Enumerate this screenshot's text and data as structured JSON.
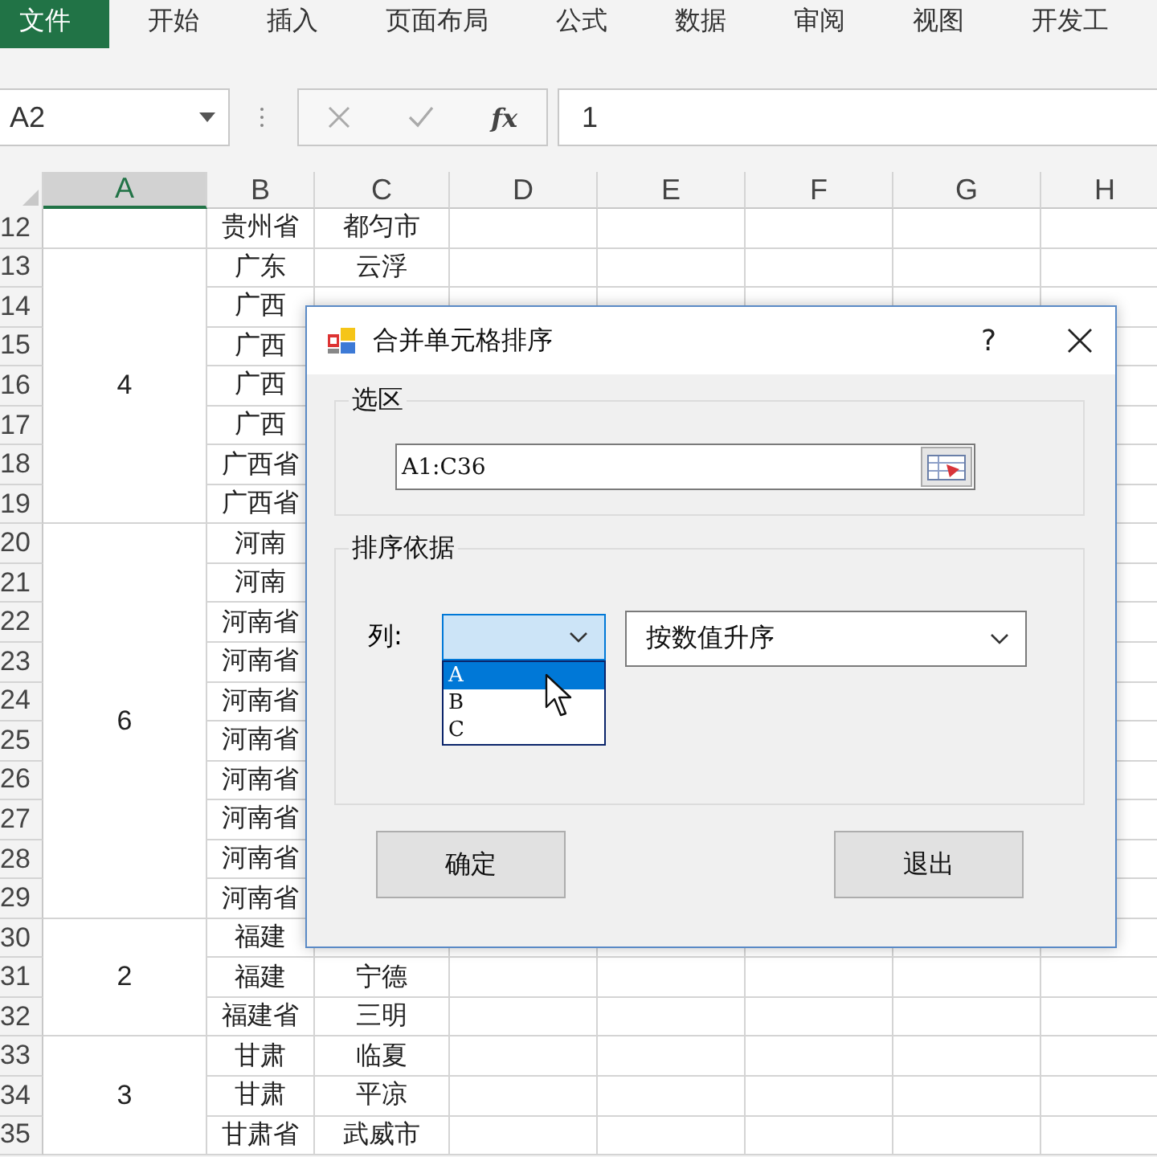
{
  "ribbon": {
    "tabs": [
      {
        "label": "文件",
        "kind": "file"
      },
      {
        "label": "开始",
        "kind": "tab"
      },
      {
        "label": "插入",
        "kind": "tab"
      },
      {
        "label": "页面布局",
        "kind": "tab"
      },
      {
        "label": "公式",
        "kind": "tab"
      },
      {
        "label": "数据",
        "kind": "tab"
      },
      {
        "label": "审阅",
        "kind": "tab"
      },
      {
        "label": "视图",
        "kind": "tab"
      },
      {
        "label": "开发工",
        "kind": "tab"
      }
    ]
  },
  "formula_bar": {
    "name_box": "A2",
    "function_label": "fx",
    "value": "1"
  },
  "sheet": {
    "columns": [
      {
        "label": "A",
        "selected": true
      },
      {
        "label": "B",
        "selected": false
      },
      {
        "label": "C",
        "selected": false
      },
      {
        "label": "D",
        "selected": false
      },
      {
        "label": "E",
        "selected": false
      },
      {
        "label": "F",
        "selected": false
      },
      {
        "label": "G",
        "selected": false
      },
      {
        "label": "H",
        "selected": false
      }
    ],
    "row_groups": [
      {
        "rows": [
          {
            "number": "12",
            "b": "贵州省",
            "c": "都匀市"
          }
        ]
      },
      {
        "a": "4",
        "rows": [
          {
            "number": "13",
            "b": "广东",
            "c": "云浮"
          },
          {
            "number": "14",
            "b": "广西"
          },
          {
            "number": "15",
            "b": "广西"
          },
          {
            "number": "16",
            "b": "广西"
          },
          {
            "number": "17",
            "b": "广西"
          },
          {
            "number": "18",
            "b": "广西省"
          },
          {
            "number": "19",
            "b": "广西省"
          }
        ]
      },
      {
        "a": "6",
        "rows": [
          {
            "number": "20",
            "b": "河南"
          },
          {
            "number": "21",
            "b": "河南"
          },
          {
            "number": "22",
            "b": "河南省"
          },
          {
            "number": "23",
            "b": "河南省"
          },
          {
            "number": "24",
            "b": "河南省"
          },
          {
            "number": "25",
            "b": "河南省"
          },
          {
            "number": "26",
            "b": "河南省"
          },
          {
            "number": "27",
            "b": "河南省"
          },
          {
            "number": "28",
            "b": "河南省"
          },
          {
            "number": "29",
            "b": "河南省"
          }
        ]
      },
      {
        "a": "2",
        "rows": [
          {
            "number": "30",
            "b": "福建"
          },
          {
            "number": "31",
            "b": "福建",
            "c": "宁德"
          },
          {
            "number": "32",
            "b": "福建省",
            "c": "三明"
          }
        ]
      },
      {
        "a": "3",
        "rows": [
          {
            "number": "33",
            "b": "甘肃",
            "c": "临夏"
          },
          {
            "number": "34",
            "b": "甘肃",
            "c": "平凉"
          },
          {
            "number": "35",
            "b": "甘肃省",
            "c": "武威市"
          }
        ]
      }
    ]
  },
  "dialog": {
    "title": "合并单元格排序",
    "help": "?",
    "selection_group": {
      "label": "选区",
      "range_field": "A1:C36"
    },
    "sort_group": {
      "label": "排序依据",
      "column_label": "列:",
      "column_combo": {
        "expanded": true,
        "options": [
          {
            "label": "A",
            "selected": true
          },
          {
            "label": "B",
            "selected": false
          },
          {
            "label": "C",
            "selected": false
          }
        ]
      },
      "order_combo": {
        "value": "按数值升序"
      }
    },
    "buttons": [
      "确定",
      "退出"
    ]
  }
}
